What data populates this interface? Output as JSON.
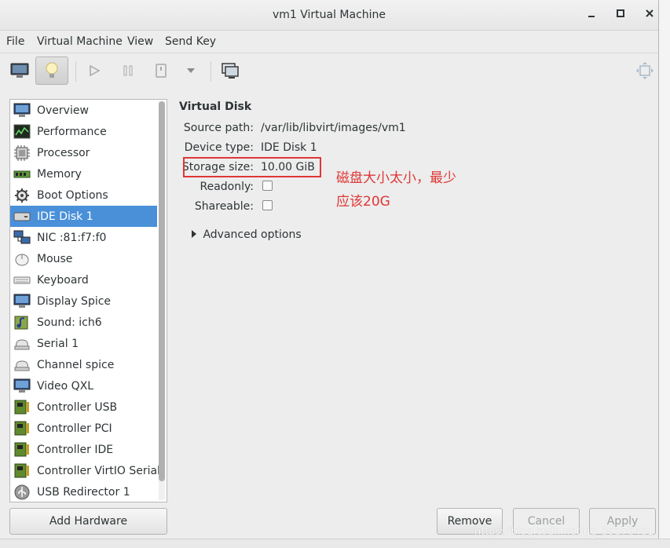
{
  "window": {
    "title": "vm1 Virtual Machine"
  },
  "menu": [
    "File",
    "Virtual Machine",
    "View",
    "Send Key"
  ],
  "toolbar": {
    "buttons": [
      "console-icon",
      "details-lightbulb-icon",
      "run-icon",
      "pause-icon",
      "shutdown-icon",
      "dropdown-icon",
      "snapshots-icon",
      "fullscreen-icon"
    ]
  },
  "sidebar": {
    "items": [
      {
        "label": "Overview",
        "icon": "monitor-icon"
      },
      {
        "label": "Performance",
        "icon": "performance-graph-icon"
      },
      {
        "label": "Processor",
        "icon": "cpu-icon"
      },
      {
        "label": "Memory",
        "icon": "memory-icon"
      },
      {
        "label": "Boot Options",
        "icon": "gear-icon"
      },
      {
        "label": "IDE Disk 1",
        "icon": "disk-icon"
      },
      {
        "label": "NIC :81:f7:f0",
        "icon": "network-icon"
      },
      {
        "label": "Mouse",
        "icon": "mouse-icon"
      },
      {
        "label": "Keyboard",
        "icon": "keyboard-icon"
      },
      {
        "label": "Display Spice",
        "icon": "monitor-icon"
      },
      {
        "label": "Sound: ich6",
        "icon": "sound-icon"
      },
      {
        "label": "Serial 1",
        "icon": "serial-icon"
      },
      {
        "label": "Channel spice",
        "icon": "channel-icon"
      },
      {
        "label": "Video QXL",
        "icon": "monitor-icon"
      },
      {
        "label": "Controller USB",
        "icon": "controller-card-icon"
      },
      {
        "label": "Controller PCI",
        "icon": "controller-card-icon"
      },
      {
        "label": "Controller IDE",
        "icon": "controller-card-icon"
      },
      {
        "label": "Controller VirtIO Serial",
        "icon": "controller-card-icon"
      },
      {
        "label": "USB Redirector 1",
        "icon": "usb-icon"
      }
    ],
    "selected": "IDE Disk 1"
  },
  "details": {
    "section_title": "Virtual Disk",
    "source_path_label": "Source path:",
    "source_path": "/var/lib/libvirt/images/vm1",
    "device_type_label": "Device type:",
    "device_type": "IDE Disk 1",
    "storage_size_label": "Storage size:",
    "storage_size": "10.00 GiB",
    "readonly_label": "Readonly:",
    "readonly_checked": false,
    "shareable_label": "Shareable:",
    "shareable_checked": false,
    "advanced_label": "Advanced options"
  },
  "annotation": {
    "line1": "磁盘大小太小，最少",
    "line2": "应该20G",
    "color": "#e03636"
  },
  "buttons": {
    "add_hardware": "Add Hardware",
    "remove": "Remove",
    "cancel": "Cancel",
    "apply": "Apply"
  },
  "colors": {
    "selection": "#4a90d9",
    "annotation": "#e03636"
  },
  "watermark": "https://blog.csdn.net/qq_39376481"
}
